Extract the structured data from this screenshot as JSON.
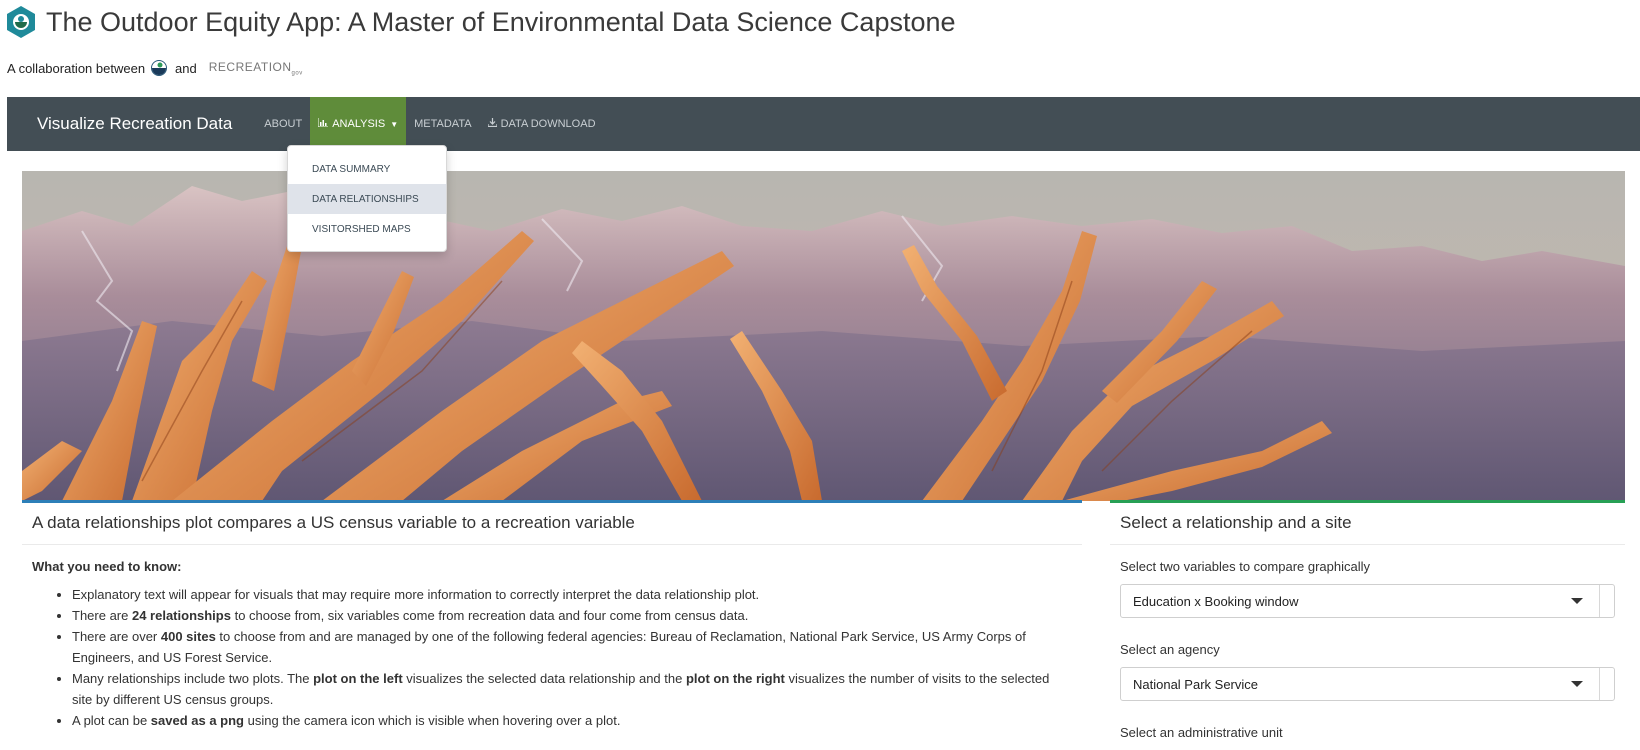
{
  "header": {
    "title": "The Outdoor Equity App: A Master of Environmental Data Science Capstone",
    "collab_prefix": "A collaboration between",
    "collab_and": "and",
    "partner_logo_text": "RECREATION",
    "partner_logo_suffix": "gov"
  },
  "navbar": {
    "brand": "Visualize Recreation Data",
    "items": [
      {
        "label": "ABOUT",
        "icon": ""
      },
      {
        "label": "ANALYSIS",
        "icon": "bar-chart-icon",
        "active": true,
        "has_caret": true
      },
      {
        "label": "METADATA",
        "icon": ""
      },
      {
        "label": "DATA DOWNLOAD",
        "icon": "download-icon"
      }
    ],
    "dropdown": [
      {
        "label": "DATA SUMMARY"
      },
      {
        "label": "DATA RELATIONSHIPS",
        "hovered": true
      },
      {
        "label": "VISITORSHED MAPS"
      }
    ]
  },
  "left_card": {
    "heading": "A data relationships plot compares a US census variable to a recreation variable",
    "subheading": "What you need to know:",
    "bullets": [
      {
        "parts": [
          {
            "t": "Explanatory text will appear for visuals that may require more information to correctly interpret the data relationship plot.",
            "b": false
          }
        ]
      },
      {
        "parts": [
          {
            "t": "There are ",
            "b": false
          },
          {
            "t": "24 relationships",
            "b": true
          },
          {
            "t": " to choose from, six variables come from recreation data and four come from census data.",
            "b": false
          }
        ]
      },
      {
        "parts": [
          {
            "t": "There are over ",
            "b": false
          },
          {
            "t": "400 sites",
            "b": true
          },
          {
            "t": " to choose from and are managed by one of the following federal agencies: Bureau of Reclamation, National Park Service, US Army Corps of Engineers, and US Forest Service.",
            "b": false
          }
        ]
      },
      {
        "parts": [
          {
            "t": "Many relationships include two plots. The ",
            "b": false
          },
          {
            "t": "plot on the left",
            "b": true
          },
          {
            "t": " visualizes the selected data relationship and the ",
            "b": false
          },
          {
            "t": "plot on the right",
            "b": true
          },
          {
            "t": " visualizes the number of visits to the selected site by different US census groups.",
            "b": false
          }
        ]
      },
      {
        "parts": [
          {
            "t": "A plot can be ",
            "b": false
          },
          {
            "t": "saved as a png",
            "b": true
          },
          {
            "t": " using the camera icon which is visible when hovering over a plot.",
            "b": false
          }
        ]
      }
    ]
  },
  "right_card": {
    "heading": "Select a relationship and a site",
    "relationship_label": "Select two variables to compare graphically",
    "relationship_value": "Education x Booking window",
    "agency_label": "Select an agency",
    "agency_value": "National Park Service",
    "admin_unit_label": "Select an administrative unit"
  },
  "colors": {
    "navbar": "#434e55",
    "active_tab": "#5f8c3a",
    "blue_accent": "#2d7fb8",
    "green_accent": "#27a055"
  }
}
